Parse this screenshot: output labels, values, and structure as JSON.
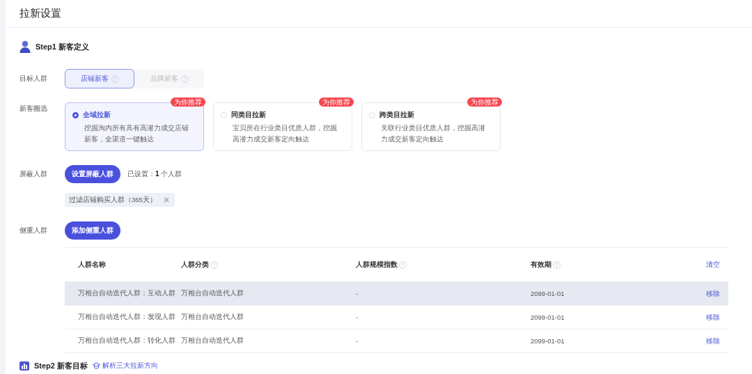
{
  "page_title": "拉新设置",
  "step1": {
    "title": "Step1 新客定义"
  },
  "target": {
    "label": "目标人群",
    "options": [
      {
        "label": "店铺新客",
        "selected": true
      },
      {
        "label": "品牌新客",
        "selected": false
      }
    ]
  },
  "selection": {
    "label": "新客圈选",
    "cards": [
      {
        "title": "全域拉新",
        "desc": "挖掘淘内所有具有高潜力成交店铺新客，全渠道一键触达",
        "badge": "为你推荐",
        "selected": true
      },
      {
        "title": "同类目拉新",
        "desc": "宝贝所在行业类目优质人群，挖掘高潜力成交新客定向触达",
        "badge": "为你推荐",
        "selected": false
      },
      {
        "title": "跨类目拉新",
        "desc": "关联行业类目优质人群，挖掘高潜力成交新客定向触达",
        "badge": "为你推荐",
        "selected": false
      }
    ]
  },
  "exclude": {
    "label": "屏蔽人群",
    "button": "设置屏蔽人群",
    "status_prefix": "已设置：",
    "status_count": "1",
    "status_suffix": "个人群",
    "tags": [
      "过滤店铺购买人群（365天）"
    ]
  },
  "focus": {
    "label": "侧重人群",
    "button": "添加侧重人群"
  },
  "table": {
    "columns": [
      {
        "label": "人群名称",
        "help": false
      },
      {
        "label": "人群分类",
        "help": true
      },
      {
        "label": "人群规模指数",
        "help": true
      },
      {
        "label": "有效期",
        "help": true
      }
    ],
    "clear_action": "清空",
    "rows": [
      {
        "name": "万相台自动迭代人群：互动人群",
        "category": "万相台自动迭代人群",
        "scale": "-",
        "validity": "2099-01-01",
        "action": "移除",
        "highlighted": true
      },
      {
        "name": "万相台自动迭代人群：发现人群",
        "category": "万相台自动迭代人群",
        "scale": "-",
        "validity": "2099-01-01",
        "action": "移除",
        "highlighted": false
      },
      {
        "name": "万相台自动迭代人群：转化人群",
        "category": "万相台自动迭代人群",
        "scale": "-",
        "validity": "2099-01-01",
        "action": "移除",
        "highlighted": false
      }
    ]
  },
  "step2": {
    "title": "Step2 新客目标",
    "link": "解析三大拉新方向"
  }
}
